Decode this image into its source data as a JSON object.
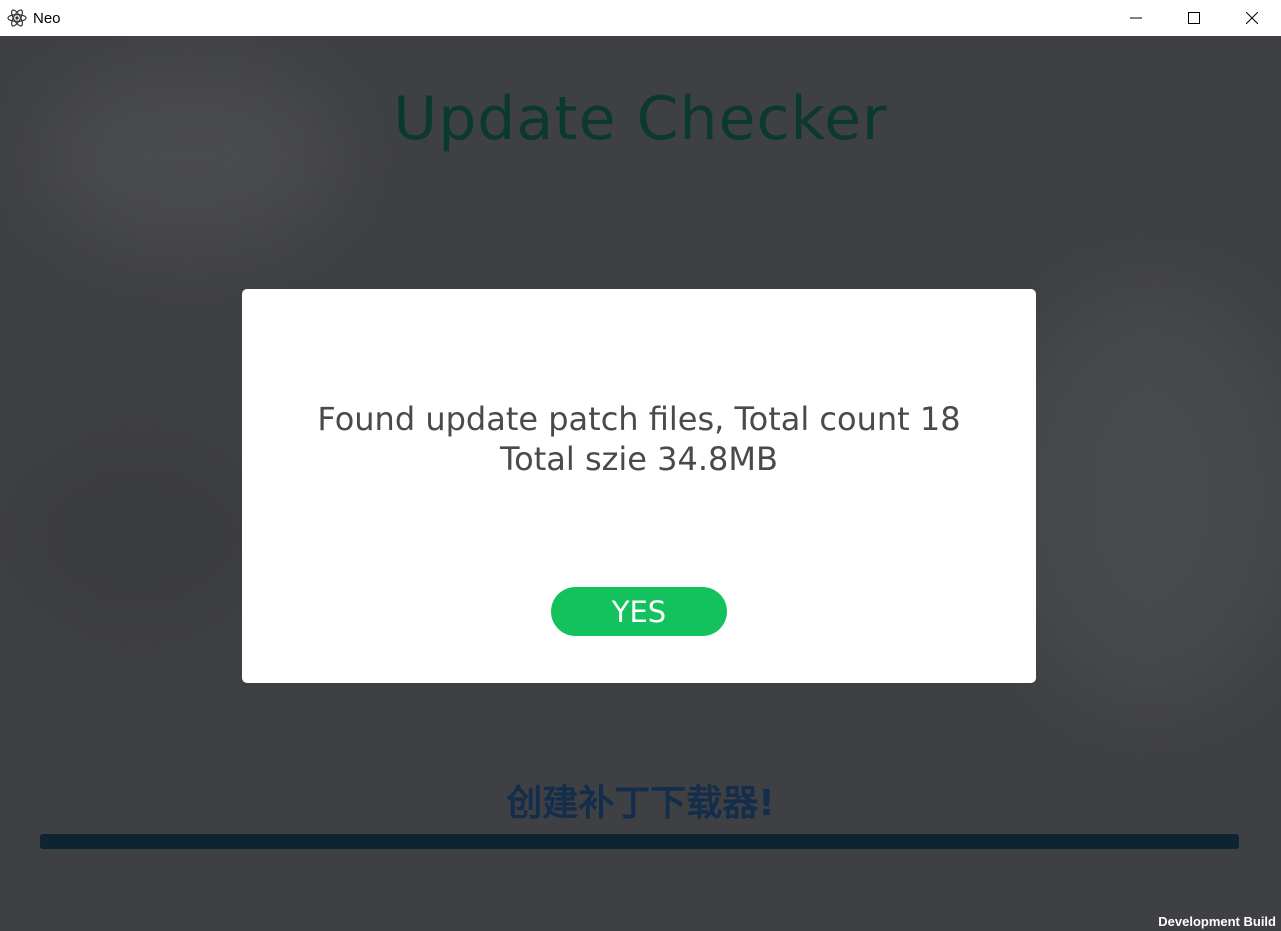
{
  "window": {
    "title": "Neo",
    "icon": "atom-icon",
    "controls": [
      "minimize-icon",
      "maximize-icon",
      "close-icon"
    ]
  },
  "main": {
    "title": "Update Checker",
    "status": "创建补丁下载器!",
    "progress": 0,
    "build_label": "Development Build"
  },
  "dialog": {
    "message_line1": "Found update patch files, Total count 18",
    "message_line2": "Total szie 34.8MB",
    "yes_label": "YES"
  },
  "colors": {
    "accent_green": "#13c15d",
    "title_color": "#0b3a2c",
    "status_color": "#142d4a",
    "background": "#3f4043"
  }
}
